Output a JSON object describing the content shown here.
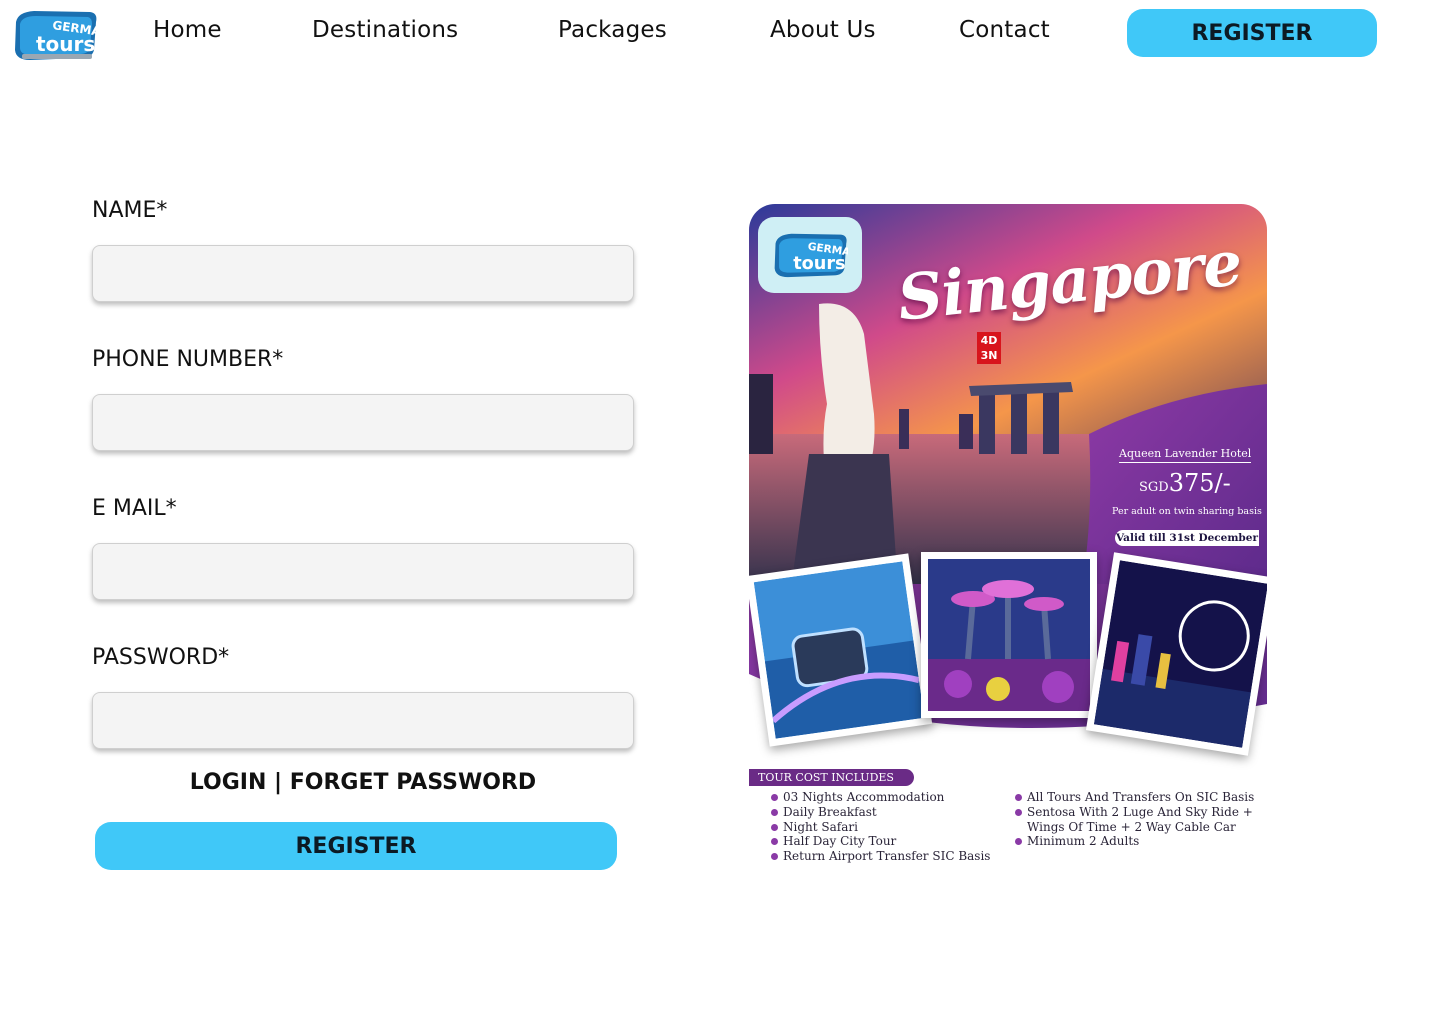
{
  "theme": {
    "accent": "#40c8f8",
    "poster_purple": "#7a2f93"
  },
  "header": {
    "logo": {
      "text_top": "GERMAN",
      "text_bottom": "tours"
    },
    "nav": [
      {
        "label": "Home"
      },
      {
        "label": "Destinations"
      },
      {
        "label": "Packages"
      },
      {
        "label": "About Us"
      },
      {
        "label": "Contact"
      }
    ],
    "register_label": "REGISTER"
  },
  "form": {
    "fields": [
      {
        "label": "NAME*",
        "value": "",
        "placeholder": ""
      },
      {
        "label": "PHONE NUMBER*",
        "value": "",
        "placeholder": ""
      },
      {
        "label": "E MAIL*",
        "value": "",
        "placeholder": ""
      },
      {
        "label": "PASSWORD*",
        "value": "",
        "placeholder": ""
      }
    ],
    "login_label": "LOGIN",
    "separator": "|",
    "forgot_label": "FORGET PASSWORD",
    "register_label": "REGISTER"
  },
  "promo": {
    "destination": "Singapore",
    "duration_days": "4D",
    "duration_nights": "3N",
    "hotel": "Aqueen Lavender Hotel",
    "currency": "SGD",
    "price": "375/-",
    "price_note": "Per adult on twin sharing basis",
    "validity": "Valid till 31st December",
    "includes_title": "TOUR COST INCLUDES",
    "includes_left": [
      "03 Nights Accommodation",
      "Daily Breakfast",
      "Night Safari",
      "Half Day City Tour",
      "Return Airport Transfer SIC Basis"
    ],
    "includes_right": [
      "All Tours And Transfers On SIC Basis",
      "Sentosa With 2 Luge And Sky Ride +",
      "Wings Of Time + 2 Way Cable Car",
      "Minimum 2 Adults"
    ]
  }
}
